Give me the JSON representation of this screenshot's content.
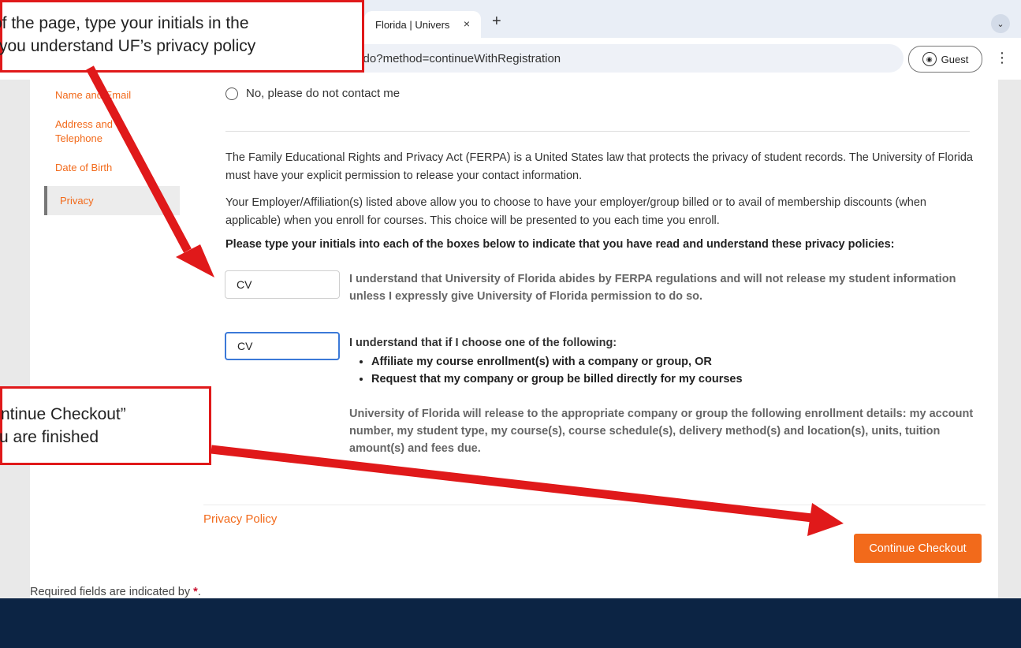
{
  "browser": {
    "tab_title": "Florida | Univers",
    "tab_close": "×",
    "new_tab": "+",
    "tab_menu": "⌄",
    "url": "reg.pwa.ufl.edu/coursebasket/public/PersonalLogon.do?method=continueWithRegistration",
    "profile_label": "Guest",
    "menu_glyph": "⋮"
  },
  "sidebar": {
    "items": [
      {
        "label": "Name and Email"
      },
      {
        "label": "Address and Telephone"
      },
      {
        "label": "Date of Birth"
      },
      {
        "label": "Privacy"
      }
    ]
  },
  "form": {
    "radio_no_label": "No, please do not contact me",
    "ferpa_paragraph": "The Family Educational Rights and Privacy Act (FERPA) is a United States law that protects the privacy of student records. The University of Florida must have your explicit permission to release your contact information.",
    "employer_paragraph": "Your Employer/Affiliation(s) listed above allow you to choose to have your employer/group billed or to avail of membership discounts (when applicable) when you enroll for courses. This choice will be presented to you each time you enroll.",
    "instructions": "Please type your initials into each of the boxes below to indicate that you have read and understand these privacy policies:",
    "initials_1": "CV",
    "initials_2": "CV",
    "policy_1": "I understand that University of Florida abides by FERPA regulations and will not release my student information unless I expressly give University of Florida permission to do so.",
    "policy_2_intro": "I understand that if I choose one of the following:",
    "policy_2_bullets": [
      "Affiliate my course enrollment(s) with a company or group, OR",
      "Request that my company or group be billed directly for my courses"
    ],
    "policy_2_detail": "University of Florida will release to the appropriate company or group the following enrollment details: my account number, my student type, my course(s), course schedule(s), delivery method(s) and location(s), units, tuition amount(s) and fees due."
  },
  "footer": {
    "privacy_link": "Privacy Policy",
    "continue_button": "Continue Checkout",
    "required_text": "Required fields are indicated by ",
    "required_star": "*",
    "required_period": "."
  },
  "annotations": {
    "top_line1": "of the page, type your initials in the",
    "top_line2": "you understand UF’s privacy policy",
    "bottom_line1": "ntinue Checkout”",
    "bottom_line2": "u are finished"
  },
  "colors": {
    "accent_orange": "#f26a1b",
    "annotation_red": "#e0191a",
    "footer_navy": "#0c2444",
    "focus_blue": "#3b79d8"
  }
}
